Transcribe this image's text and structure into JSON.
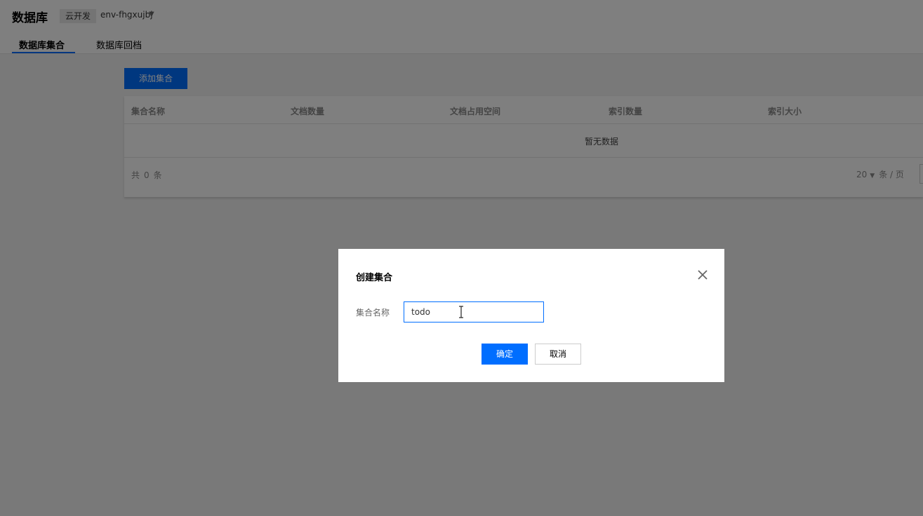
{
  "header": {
    "title": "数据库",
    "env_tag": "云开发",
    "env_name": "env-fhgxujbj",
    "env_dropdown_icon": "caret-down-icon"
  },
  "tabs": [
    {
      "label": "数据库集合",
      "active": true
    },
    {
      "label": "数据库回档",
      "active": false
    }
  ],
  "toolbar": {
    "add_collection_label": "添加集合"
  },
  "table": {
    "columns": [
      "集合名称",
      "文档数量",
      "文档占用空间",
      "索引数量",
      "索引大小"
    ],
    "empty_text": "暂无数据",
    "footer": {
      "total_prefix": "共",
      "total_count": "0",
      "total_suffix": "条",
      "page_size": "20",
      "page_size_suffix": "条 / 页"
    }
  },
  "dialog": {
    "title": "创建集合",
    "field_label": "集合名称",
    "input_value": "todo",
    "confirm_label": "确定",
    "cancel_label": "取消"
  },
  "colors": {
    "accent": "#006eff",
    "overlay": "rgba(0,0,0,0.5)"
  }
}
